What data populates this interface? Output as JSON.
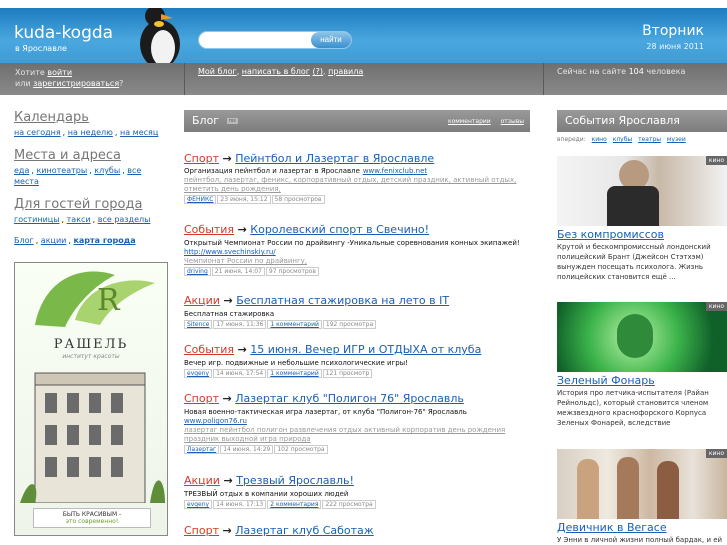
{
  "header": {
    "logo": "kuda-kogda",
    "city": "в Ярославле",
    "search_button": "найти",
    "day": "Вторник",
    "date": "28 июня 2011"
  },
  "bar": {
    "want": "Хотите",
    "login": "войти",
    "or": "или",
    "register": "зарегистрироваться",
    "q": "?",
    "my_blog": "Мой блог",
    "write": "написать в блог",
    "write_count": "(?)",
    "rules": "правила",
    "online_prefix": "Сейчас на сайте",
    "online_count": "104",
    "online_suffix": "человека"
  },
  "left": {
    "calendar": "Календарь",
    "today": "на сегодня",
    "week": "на неделю",
    "month": "на месяц",
    "places": "Места и адреса",
    "food": "еда",
    "cinemas": "кинотеатры",
    "clubs": "клубы",
    "all_places": "все места",
    "guests": "Для гостей города",
    "hotels": "гостиницы",
    "taxi": "такси",
    "all_sections": "все разделы",
    "blog": "Блог",
    "actions": "акции",
    "map": "карта города"
  },
  "ad": {
    "brand": "РАШЕЛЬ",
    "sub": "институт красоты",
    "tag1": "БЫТЬ КРАСИВЫМ -",
    "tag2": "это современно!"
  },
  "blog": {
    "title": "Блог",
    "rss": "rss",
    "tab_comments": "комментарии",
    "tab_reviews": "отзывы"
  },
  "posts": [
    {
      "cat": "Спорт",
      "title": "Пейнтбол и Лазертаг в Ярославле",
      "desc": "Организация пейнтбол и лазертаг в Ярославле",
      "url": "www.fenixclub.net",
      "tags": "пейнтбол, лазертаг, феникс, корпоративный отдых, детский праздник, активный отдых, отметить день рождения,",
      "author": "ФЕНИКС",
      "date": "23 июня, 15:12",
      "views": "58 просмотров",
      "comments": ""
    },
    {
      "cat": "События",
      "title": "Королевский спорт в Свечино!",
      "desc": "Открытый Чемпионат России по драйвингу -Уникальные соревнования конных экипажей!",
      "url": "http://www.svechinskiy.ru/",
      "tags": "Чемпионат России по драйвингу,",
      "author": "driving",
      "date": "21 июня, 14:07",
      "views": "97 просмотров",
      "comments": ""
    },
    {
      "cat": "Акции",
      "title": "Бесплатная стажировка на лето в IT",
      "desc": "Бесплатная стажировка",
      "url": "",
      "tags": "",
      "author": "Sitence",
      "date": "17 июня, 11:36",
      "views": "192 просмотра",
      "comments": "1 комментарий"
    },
    {
      "cat": "События",
      "title": "15 июня. Вечер ИГР и ОТДЫХА от клуба",
      "desc": "Вечер игр. подвижные и небольшие психологические игры!",
      "url": "",
      "tags": "",
      "author": "evgeny",
      "date": "14 июня, 17:54",
      "views": "121 просмотр",
      "comments": "1 комментарий"
    },
    {
      "cat": "Спорт",
      "title": "Лазертаг клуб \"Полигон 76\" Ярославль",
      "desc": "Новая военно-тактическая игра лазертаг, от клуба \"Полигон-76\" Ярославль",
      "url": "www.poligon76.ru",
      "tags": "лазертаг пейнтбол полигон развлечения отдых активный корпоратив день рождения праздник выходной игра природа",
      "author": "Лазертаг",
      "date": "14 июня, 14:29",
      "views": "102 просмотра",
      "comments": ""
    },
    {
      "cat": "Акции",
      "title": "Трезвый Ярославль!",
      "desc": "ТРЕЗВЫЙ отдых в компании хороших людей",
      "url": "",
      "tags": "",
      "author": "evgeny",
      "date": "14 июня, 17:13",
      "views": "222 просмотра",
      "comments": "2 комментария"
    },
    {
      "cat": "Спорт",
      "title": "Лазертаг клуб Саботаж",
      "desc": "",
      "url": "",
      "tags": "",
      "author": "",
      "date": "",
      "views": "",
      "comments": ""
    }
  ],
  "right": {
    "title": "События Ярославля",
    "ahead": "впереди:",
    "kino": "кино",
    "clubs": "клубы",
    "theatres": "театры",
    "museums": "музеи",
    "movies": [
      {
        "badge": "кино",
        "title": "Без компромиссов",
        "desc": "Крутой и бескомпромиссный лондонский полицейский Брант (Джейсон Стэтхэм) вынужден посещать психолога. Жизнь полицейских становится ещё ..."
      },
      {
        "badge": "кино",
        "title": "Зеленый Фонарь",
        "desc": "История про летчика-испытателя (Райан Рейнольдс), который становится членом межзвездного краснофорского Корпуса Зеленых Фонарей, вследствие"
      },
      {
        "badge": "кино",
        "title": "Девичник в Вегасе",
        "desc": "У Энни в личной жизни полный бардак, и ей"
      }
    ]
  }
}
